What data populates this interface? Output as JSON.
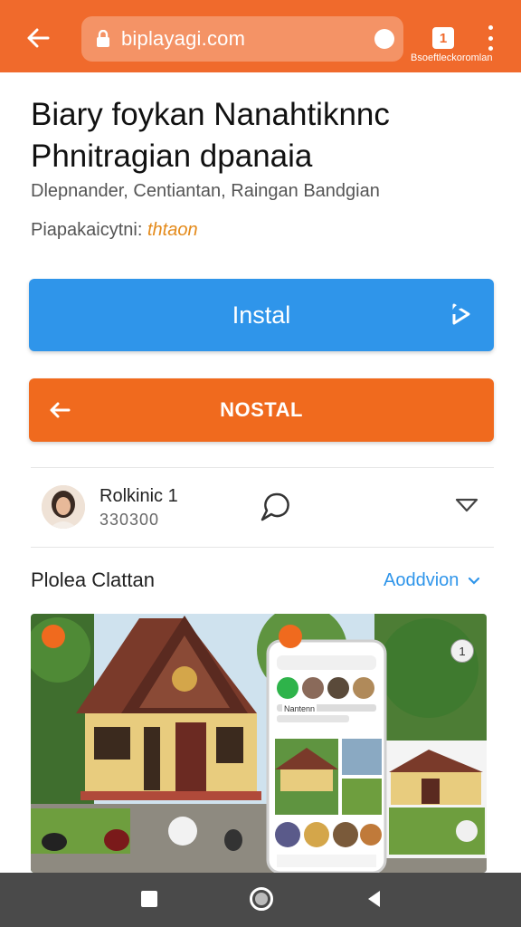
{
  "browser": {
    "url": "biplayagi.com",
    "tab_count": "1",
    "caption": "Bsoeftleckoromlan"
  },
  "app": {
    "title_line1": "Biary foykan Nanahtiknnc",
    "title_line2": "Phnitragian dpanaia",
    "subtitle": "Dlepnander, Centiantan, Raingan Bandgian",
    "meta_label": "Piapakaicytni: ",
    "meta_value": "thtaon"
  },
  "buttons": {
    "install_label": "Instal",
    "nostal_label": "NOSTAL"
  },
  "developer": {
    "name": "Rolkinic 1",
    "count": "330300"
  },
  "section": {
    "title": "Plolea Clattan",
    "link": "Aoddvion"
  },
  "screenshot_card": {
    "app_label": "Nantenn",
    "badge_number": "1"
  },
  "colors": {
    "topbar": "#f06a2c",
    "install": "#2f95ea",
    "nostal": "#f06a1e",
    "link": "#2f95ea",
    "navbar": "#4a4a4a"
  },
  "icons": {
    "back": "arrow-left-icon",
    "lock": "lock-icon",
    "tabs": "tabs-icon",
    "menu": "more-vert-icon",
    "share": "share-icon",
    "comment": "comment-icon",
    "dropdown": "chevron-down-icon",
    "recents": "recents-icon",
    "home": "home-icon",
    "back_nav": "back-triangle-icon"
  }
}
